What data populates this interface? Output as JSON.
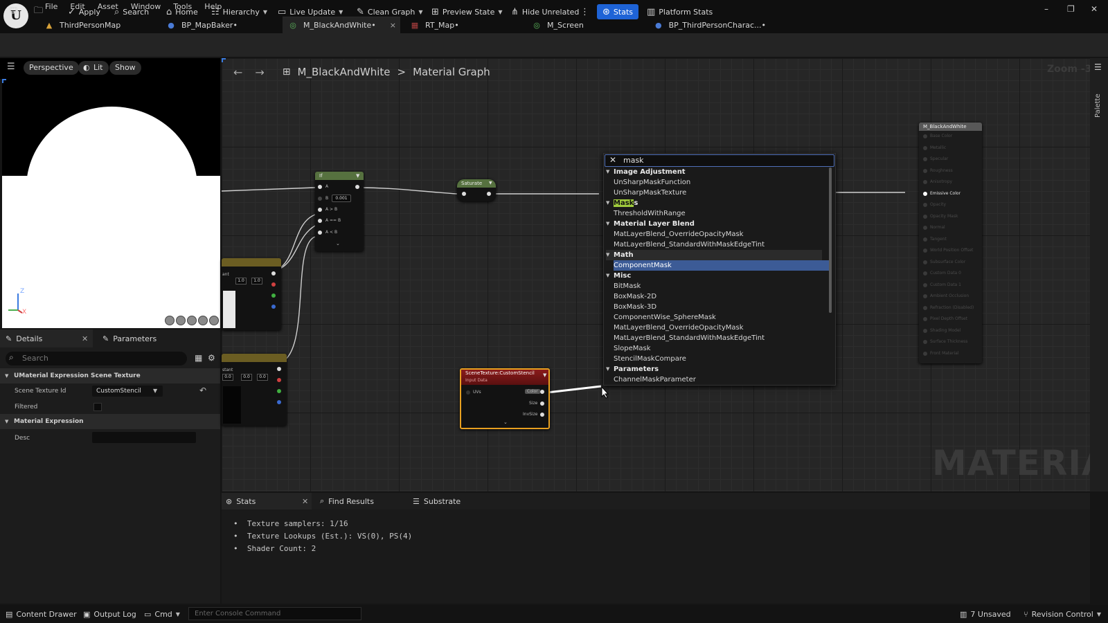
{
  "menu": [
    "File",
    "Edit",
    "Asset",
    "Window",
    "Tools",
    "Help"
  ],
  "logo_text": "U",
  "doc_tabs": [
    {
      "label": "ThirdPersonMap",
      "icon": "level-icon",
      "color": "#d8a23a"
    },
    {
      "label": "BP_MapBaker•",
      "icon": "blueprint-icon",
      "color": "#4a7bd6"
    },
    {
      "label": "M_BlackAndWhite•",
      "icon": "material-icon",
      "color": "#5cb85c",
      "active": true,
      "close": "×"
    },
    {
      "label": "RT_Map•",
      "icon": "render-target-icon",
      "color": "#b04040"
    },
    {
      "label": "M_Screen",
      "icon": "material-icon",
      "color": "#5cb85c"
    },
    {
      "label": "BP_ThirdPersonCharac...•",
      "icon": "blueprint-icon",
      "color": "#4a7bd6"
    }
  ],
  "window_controls": {
    "minimize": "–",
    "restore": "❐",
    "close": "✕"
  },
  "toolbar": {
    "apply": "Apply",
    "search": "Search",
    "home": "Home",
    "hierarchy": "Hierarchy",
    "live_update": "Live Update",
    "clean_graph": "Clean Graph",
    "preview_state": "Preview State",
    "hide_unrelated": "Hide Unrelated",
    "stats": "Stats",
    "platform_stats": "Platform Stats"
  },
  "viewport": {
    "perspective": "Perspective",
    "lit": "Lit",
    "show": "Show",
    "axis_z": "Z",
    "axis_x": "X"
  },
  "details": {
    "tab_details": "Details",
    "tab_parameters": "Parameters",
    "search_placeholder": "Search",
    "section_scene_texture": "UMaterial Expression Scene Texture",
    "label_scene_texture_id": "Scene Texture Id",
    "scene_texture_id_value": "CustomStencil",
    "label_filtered": "Filtered",
    "section_material_expression": "Material Expression",
    "label_desc": "Desc"
  },
  "graph": {
    "breadcrumb_root": "M_BlackAndWhite",
    "breadcrumb_sep": ">",
    "breadcrumb_page": "Material Graph",
    "zoom": "Zoom -3",
    "watermark": "MATERIAL",
    "palette": "Palette"
  },
  "nodes": {
    "if_title": "If",
    "if_pins": [
      "A",
      "B",
      "A > B",
      "A == B",
      "A < B"
    ],
    "if_b_value": "0.001",
    "saturate_title": "Saturate",
    "scene_texture_title": "SceneTexture:CustomStencil",
    "scene_texture_subtitle": "Input Data",
    "scene_texture_in": "UVs",
    "scene_texture_outs": [
      "Color",
      "Size",
      "InvSize"
    ],
    "const1_values": [
      "1.0",
      "1.0"
    ],
    "const1_label": "ant",
    "const2_values": [
      "0.0",
      "0.0",
      "0.0"
    ],
    "const2_label": "stant",
    "result_title": "M_BlackAndWhite",
    "result_pins": [
      "Base Color",
      "Metallic",
      "Specular",
      "Roughness",
      "Anisotropy",
      "Emissive Color",
      "Opacity",
      "Opacity Mask",
      "Normal",
      "Tangent",
      "World Position Offset",
      "Subsurface Color",
      "Custom Data 0",
      "Custom Data 1",
      "Ambient Occlusion",
      "Refraction (Disabled)",
      "Pixel Depth Offset",
      "Shading Model",
      "Surface Thickness",
      "Front Material"
    ]
  },
  "popup": {
    "query": "mask",
    "close": "✕",
    "items": [
      {
        "type": "cat",
        "label": "Image Adjustment"
      },
      {
        "type": "item",
        "label": "UnSharpMaskFunction"
      },
      {
        "type": "item",
        "label": "UnSharpMaskTexture"
      },
      {
        "type": "cat",
        "label": "Masks",
        "highlight": "Mask"
      },
      {
        "type": "item",
        "label": "ThresholdWithRange"
      },
      {
        "type": "cat",
        "label": "Material Layer Blend"
      },
      {
        "type": "item",
        "label": "MatLayerBlend_OverrideOpacityMask"
      },
      {
        "type": "item",
        "label": "MatLayerBlend_StandardWithMaskEdgeTint"
      },
      {
        "type": "cat",
        "label": "Math",
        "cathl": true
      },
      {
        "type": "item",
        "label": "ComponentMask",
        "selected": true
      },
      {
        "type": "cat",
        "label": "Misc"
      },
      {
        "type": "item",
        "label": "BitMask"
      },
      {
        "type": "item",
        "label": "BoxMask-2D"
      },
      {
        "type": "item",
        "label": "BoxMask-3D"
      },
      {
        "type": "item",
        "label": "ComponentWise_SphereMask"
      },
      {
        "type": "item",
        "label": "MatLayerBlend_OverrideOpacityMask"
      },
      {
        "type": "item",
        "label": "MatLayerBlend_StandardWithMaskEdgeTint"
      },
      {
        "type": "item",
        "label": "SlopeMask"
      },
      {
        "type": "item",
        "label": "StencilMaskCompare"
      },
      {
        "type": "cat",
        "label": "Parameters"
      },
      {
        "type": "item",
        "label": "ChannelMaskParameter"
      }
    ]
  },
  "stats_panel": {
    "tab_stats": "Stats",
    "tab_find": "Find Results",
    "tab_substrate": "Substrate",
    "lines": [
      "Texture samplers: 1/16",
      "Texture Lookups (Est.): VS(0), PS(4)",
      "Shader Count: 2"
    ]
  },
  "statusbar": {
    "content_drawer": "Content Drawer",
    "output_log": "Output Log",
    "cmd": "Cmd",
    "console_placeholder": "Enter Console Command",
    "unsaved": "7 Unsaved",
    "revision_control": "Revision Control"
  },
  "colors": {
    "accent": "#1e63d6",
    "selection": "#3c5b96",
    "highlight": "#9fcb3c",
    "scene_texture_border": "#e8a020"
  }
}
